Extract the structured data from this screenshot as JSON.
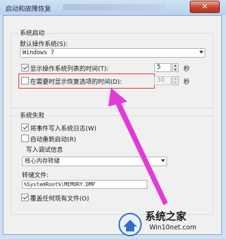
{
  "window": {
    "title": "启动和故障恢复",
    "close_label": "✕"
  },
  "system_startup": {
    "group_title": "系统启动",
    "default_os_label": "默认操作系统(S):",
    "default_os_value": "Windows 7",
    "show_os_list": {
      "label": "显示操作系统列表的时间(T):",
      "checked": true,
      "value": "5",
      "unit": "秒"
    },
    "show_recovery": {
      "label": "在需要时显示恢复选项的时间(D):",
      "checked": false,
      "value": "30",
      "unit": "秒"
    }
  },
  "system_failure": {
    "group_title": "系统失败",
    "write_event_log": {
      "label": "将事件写入系统日志(W)",
      "checked": true
    },
    "auto_restart": {
      "label": "自动重新启动(R)",
      "checked": false
    },
    "debug_info": {
      "group_title": "写入调试信息",
      "dump_type": "核心内存转储",
      "dump_file_label": "转储文件:",
      "dump_file_value": "%SystemRoot%\\MEMORY.DMP",
      "overwrite": {
        "label": "覆盖任何现有文件(O)",
        "checked": true
      }
    }
  },
  "watermark": {
    "brand": "系统之家",
    "url": "Win10net.com"
  },
  "colors": {
    "highlight": "#e4352f",
    "arrow": "#e23ad6",
    "title_gradient_top": "#cfe1f5",
    "close_button": "#c8432c"
  }
}
